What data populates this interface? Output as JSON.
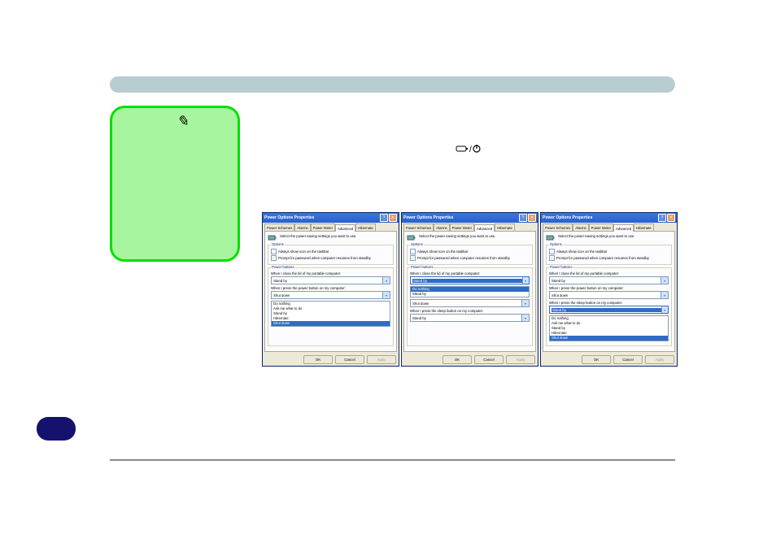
{
  "dlg": {
    "title": "Power Options Properties",
    "tabs": [
      "Power Schemes",
      "Alarms",
      "Power Meter",
      "Advanced",
      "Hibernate"
    ],
    "intro": "Select the power-saving settings you want to use.",
    "opt_legend": "Options",
    "chk_icon": "Always show icon on the taskbar",
    "chk_pw": "Prompt for password when computer resumes from standby",
    "pb_legend": "Power buttons",
    "q_lid": "When I close the lid of my portable computer:",
    "q_power": "When I press the power button on my computer:",
    "q_sleep": "When I press the sleep button on my computer:",
    "v_standby": "Stand by",
    "v_shutdown": "Shut down",
    "v_donothing": "Do nothing",
    "v_ask": "Ask me what to do",
    "v_hibernate": "Hibernate",
    "ok": "OK",
    "cancel": "Cancel",
    "apply": "Apply"
  }
}
